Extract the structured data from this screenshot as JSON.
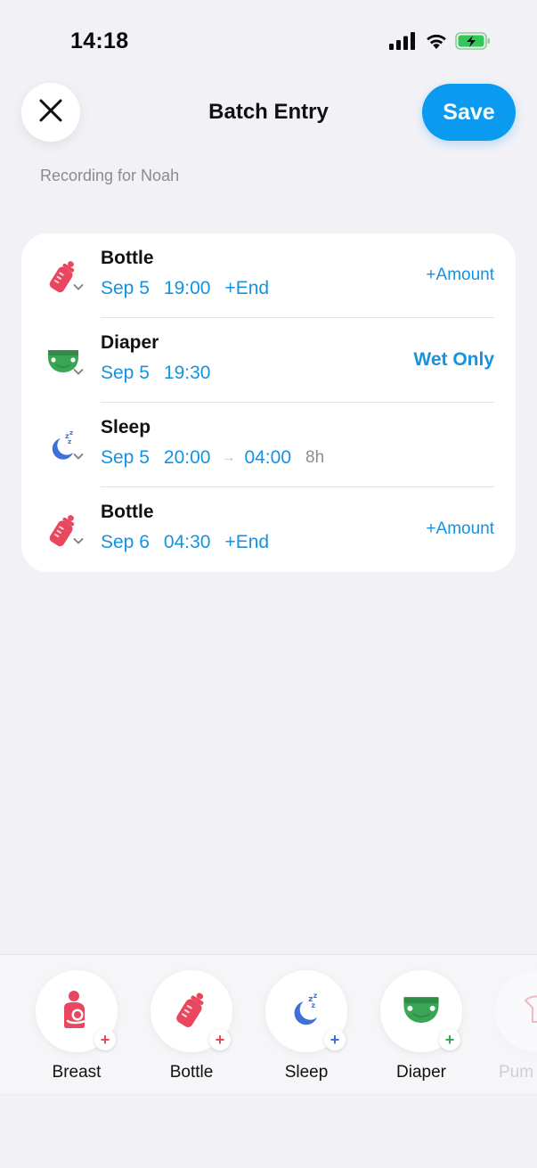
{
  "status": {
    "time": "14:18"
  },
  "header": {
    "title": "Batch Entry",
    "save_label": "Save"
  },
  "subtitle": "Recording for Noah",
  "entries": [
    {
      "type": "Bottle",
      "date": "Sep 5",
      "time": "19:00",
      "end_label": "+End",
      "right_label": "+Amount",
      "icon": "bottle-icon"
    },
    {
      "type": "Diaper",
      "date": "Sep 5",
      "time": "19:30",
      "right_label": "Wet Only",
      "icon": "diaper-icon"
    },
    {
      "type": "Sleep",
      "date": "Sep 5",
      "time": "20:00",
      "arrow": "→",
      "end_time": "04:00",
      "duration": "8h",
      "icon": "sleep-icon"
    },
    {
      "type": "Bottle",
      "date": "Sep 6",
      "time": "04:30",
      "end_label": "+End",
      "right_label": "+Amount",
      "icon": "bottle-icon"
    }
  ],
  "quick_add": [
    {
      "label": "Breast",
      "icon": "breastfeeding-icon",
      "plus": "+",
      "color": "#e8475f"
    },
    {
      "label": "Bottle",
      "icon": "bottle-icon",
      "plus": "+",
      "color": "#e8475f"
    },
    {
      "label": "Sleep",
      "icon": "sleep-icon",
      "plus": "+",
      "color": "#3f6fd8"
    },
    {
      "label": "Diaper",
      "icon": "diaper-icon",
      "plus": "+",
      "color": "#3aa655"
    },
    {
      "label": "Pum",
      "icon": "pump-icon",
      "plus": "",
      "color": "#e8475f"
    }
  ],
  "colors": {
    "accent": "#0a9bf0",
    "link": "#1592e0",
    "background": "#f1f1f6"
  }
}
